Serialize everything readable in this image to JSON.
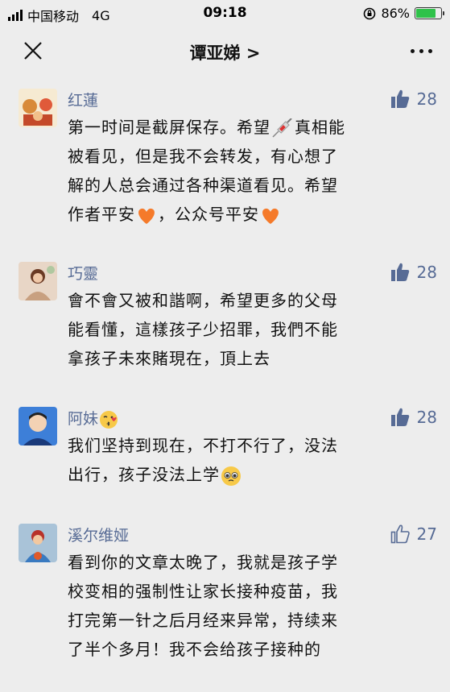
{
  "status_bar": {
    "carrier": "中国移动",
    "network": "4G",
    "time": "09:18",
    "battery": "86%",
    "battery_level": 0.86,
    "battery_color": "#2fc24a"
  },
  "nav": {
    "title": "谭亚娣 >"
  },
  "link_color": "#576b95",
  "comments": [
    {
      "name": "红蓮",
      "likes": "28",
      "like_filled": true,
      "lines": [
        "第一时间是截屏保存。希望",
        "被看见，但是我不会转发，有心想了",
        "解的人总会通过各种渠道看见。希望",
        "作者平安",
        "，公众号平安"
      ],
      "line1_rest": "真相能"
    },
    {
      "name": "巧靈",
      "likes": "28",
      "like_filled": true,
      "lines": [
        "會不會又被和諧啊，希望更多的父母",
        "能看懂，這樣孩子少招罪，我們不能",
        "拿孩子未來賭現在，頂上去"
      ]
    },
    {
      "name": "阿妹",
      "likes": "28",
      "like_filled": true,
      "lines": [
        "我们坚持到现在，不打不行了，没法",
        "出行，孩子没法上学"
      ]
    },
    {
      "name": "溪尔维娅",
      "likes": "27",
      "like_filled": false,
      "lines": [
        "看到你的文章太晚了，我就是孩子学",
        "校变相的强制性让家长接种疫苗，我",
        "打完第一针之后月经来异常，持续来",
        "了半个多月！我不会给孩子接种的"
      ]
    }
  ]
}
